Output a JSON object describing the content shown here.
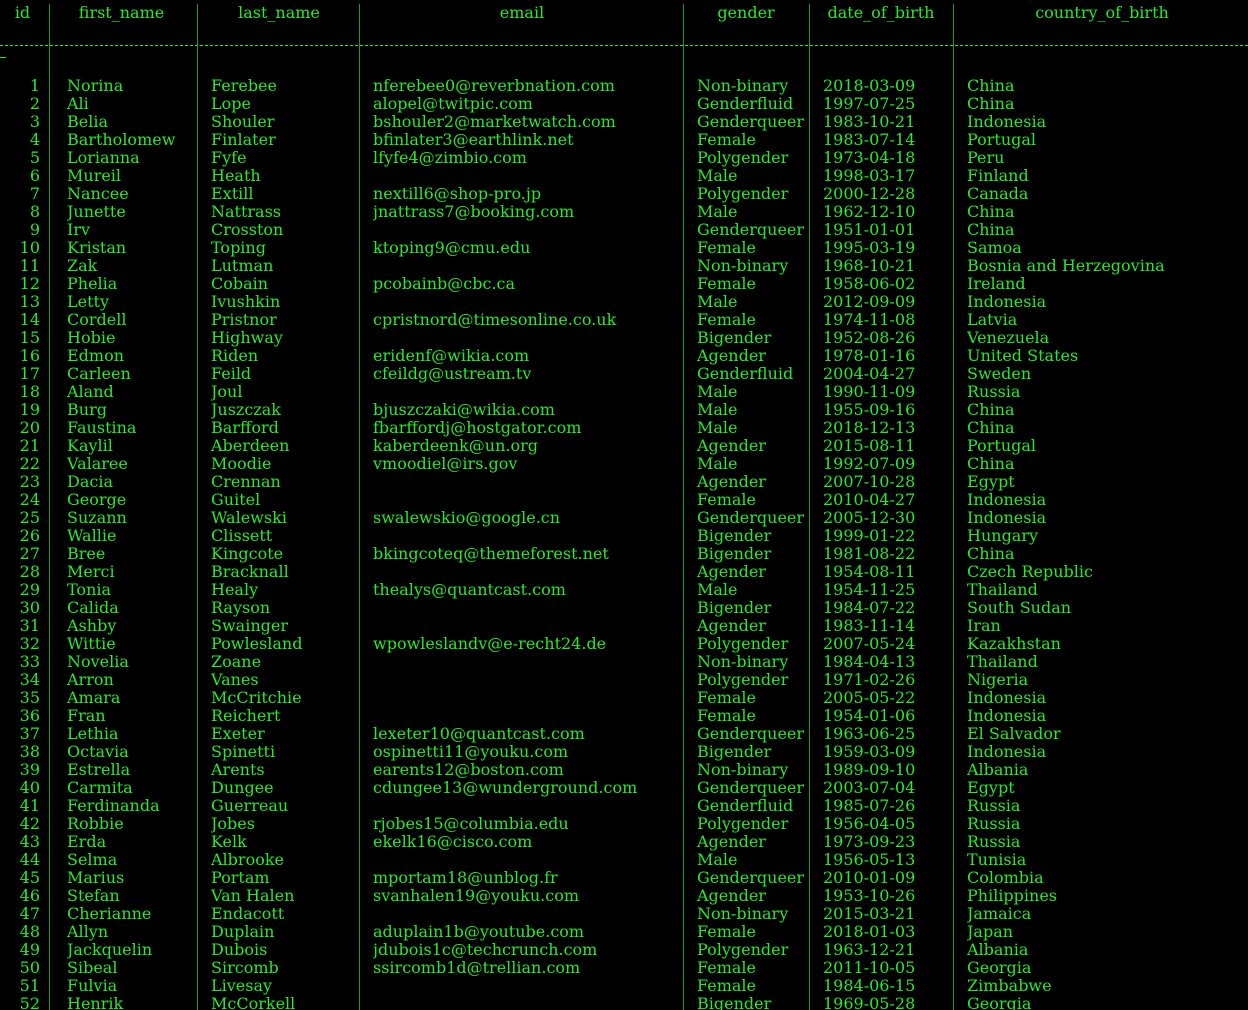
{
  "columns": [
    "id",
    "first_name",
    "last_name",
    "email",
    "gender",
    "date_of_birth",
    "country_of_birth"
  ],
  "rows": [
    [
      "1",
      "Norina",
      "Ferebee",
      "nferebee0@reverbnation.com",
      "Non-binary",
      "2018-03-09",
      "China"
    ],
    [
      "2",
      "Ali",
      "Lope",
      "alopel@twitpic.com",
      "Genderfluid",
      "1997-07-25",
      "China"
    ],
    [
      "3",
      "Belia",
      "Shouler",
      "bshouler2@marketwatch.com",
      "Genderqueer",
      "1983-10-21",
      "Indonesia"
    ],
    [
      "4",
      "Bartholomew",
      "Finlater",
      "bfinlater3@earthlink.net",
      "Female",
      "1983-07-14",
      "Portugal"
    ],
    [
      "5",
      "Lorianna",
      "Fyfe",
      "lfyfe4@zimbio.com",
      "Polygender",
      "1973-04-18",
      "Peru"
    ],
    [
      "6",
      "Mureil",
      "Heath",
      "",
      "Male",
      "1998-03-17",
      "Finland"
    ],
    [
      "7",
      "Nancee",
      "Extill",
      "nextill6@shop-pro.jp",
      "Polygender",
      "2000-12-28",
      "Canada"
    ],
    [
      "8",
      "Junette",
      "Nattrass",
      "jnattrass7@booking.com",
      "Male",
      "1962-12-10",
      "China"
    ],
    [
      "9",
      "Irv",
      "Crosston",
      "",
      "Genderqueer",
      "1951-01-01",
      "China"
    ],
    [
      "10",
      "Kristan",
      "Toping",
      "ktoping9@cmu.edu",
      "Female",
      "1995-03-19",
      "Samoa"
    ],
    [
      "11",
      "Zak",
      "Lutman",
      "",
      "Non-binary",
      "1968-10-21",
      "Bosnia and Herzegovina"
    ],
    [
      "12",
      "Phelia",
      "Cobain",
      "pcobainb@cbc.ca",
      "Female",
      "1958-06-02",
      "Ireland"
    ],
    [
      "13",
      "Letty",
      "Ivushkin",
      "",
      "Male",
      "2012-09-09",
      "Indonesia"
    ],
    [
      "14",
      "Cordell",
      "Pristnor",
      "cpristnord@timesonline.co.uk",
      "Female",
      "1974-11-08",
      "Latvia"
    ],
    [
      "15",
      "Hobie",
      "Highway",
      "",
      "Bigender",
      "1952-08-26",
      "Venezuela"
    ],
    [
      "16",
      "Edmon",
      "Riden",
      "eridenf@wikia.com",
      "Agender",
      "1978-01-16",
      "United States"
    ],
    [
      "17",
      "Carleen",
      "Feild",
      "cfeildg@ustream.tv",
      "Genderfluid",
      "2004-04-27",
      "Sweden"
    ],
    [
      "18",
      "Aland",
      "Joul",
      "",
      "Male",
      "1990-11-09",
      "Russia"
    ],
    [
      "19",
      "Burg",
      "Juszczak",
      "bjuszczaki@wikia.com",
      "Male",
      "1955-09-16",
      "China"
    ],
    [
      "20",
      "Faustina",
      "Barfford",
      "fbarffordj@hostgator.com",
      "Male",
      "2018-12-13",
      "China"
    ],
    [
      "21",
      "Kaylil",
      "Aberdeen",
      "kaberdeenk@un.org",
      "Agender",
      "2015-08-11",
      "Portugal"
    ],
    [
      "22",
      "Valaree",
      "Moodie",
      "vmoodiel@irs.gov",
      "Male",
      "1992-07-09",
      "China"
    ],
    [
      "23",
      "Dacia",
      "Crennan",
      "",
      "Agender",
      "2007-10-28",
      "Egypt"
    ],
    [
      "24",
      "George",
      "Guitel",
      "",
      "Female",
      "2010-04-27",
      "Indonesia"
    ],
    [
      "25",
      "Suzann",
      "Walewski",
      "swalewskio@google.cn",
      "Genderqueer",
      "2005-12-30",
      "Indonesia"
    ],
    [
      "26",
      "Wallie",
      "Clissett",
      "",
      "Bigender",
      "1999-01-22",
      "Hungary"
    ],
    [
      "27",
      "Bree",
      "Kingcote",
      "bkingcoteq@themeforest.net",
      "Bigender",
      "1981-08-22",
      "China"
    ],
    [
      "28",
      "Merci",
      "Bracknall",
      "",
      "Agender",
      "1954-08-11",
      "Czech Republic"
    ],
    [
      "29",
      "Tonia",
      "Healy",
      "thealys@quantcast.com",
      "Male",
      "1954-11-25",
      "Thailand"
    ],
    [
      "30",
      "Calida",
      "Rayson",
      "",
      "Bigender",
      "1984-07-22",
      "South Sudan"
    ],
    [
      "31",
      "Ashby",
      "Swainger",
      "",
      "Agender",
      "1983-11-14",
      "Iran"
    ],
    [
      "32",
      "Wittie",
      "Powlesland",
      "wpowleslandv@e-recht24.de",
      "Polygender",
      "2007-05-24",
      "Kazakhstan"
    ],
    [
      "33",
      "Novelia",
      "Zoane",
      "",
      "Non-binary",
      "1984-04-13",
      "Thailand"
    ],
    [
      "34",
      "Arron",
      "Vanes",
      "",
      "Polygender",
      "1971-02-26",
      "Nigeria"
    ],
    [
      "35",
      "Amara",
      "McCritchie",
      "",
      "Female",
      "2005-05-22",
      "Indonesia"
    ],
    [
      "36",
      "Fran",
      "Reichert",
      "",
      "Female",
      "1954-01-06",
      "Indonesia"
    ],
    [
      "37",
      "Lethia",
      "Exeter",
      "lexeter10@quantcast.com",
      "Genderqueer",
      "1963-06-25",
      "El Salvador"
    ],
    [
      "38",
      "Octavia",
      "Spinetti",
      "ospinetti11@youku.com",
      "Bigender",
      "1959-03-09",
      "Indonesia"
    ],
    [
      "39",
      "Estrella",
      "Arents",
      "earents12@boston.com",
      "Non-binary",
      "1989-09-10",
      "Albania"
    ],
    [
      "40",
      "Carmita",
      "Dungee",
      "cdungee13@wunderground.com",
      "Genderqueer",
      "2003-07-04",
      "Egypt"
    ],
    [
      "41",
      "Ferdinanda",
      "Guerreau",
      "",
      "Genderfluid",
      "1985-07-26",
      "Russia"
    ],
    [
      "42",
      "Robbie",
      "Jobes",
      "rjobes15@columbia.edu",
      "Polygender",
      "1956-04-05",
      "Russia"
    ],
    [
      "43",
      "Erda",
      "Kelk",
      "ekelk16@cisco.com",
      "Agender",
      "1973-09-23",
      "Russia"
    ],
    [
      "44",
      "Selma",
      "Albrooke",
      "",
      "Male",
      "1956-05-13",
      "Tunisia"
    ],
    [
      "45",
      "Marius",
      "Portam",
      "mportam18@unblog.fr",
      "Genderqueer",
      "2010-01-09",
      "Colombia"
    ],
    [
      "46",
      "Stefan",
      "Van Halen",
      "svanhalen19@youku.com",
      "Agender",
      "1953-10-26",
      "Philippines"
    ],
    [
      "47",
      "Cherianne",
      "Endacott",
      "",
      "Non-binary",
      "2015-03-21",
      "Jamaica"
    ],
    [
      "48",
      "Allyn",
      "Duplain",
      "aduplain1b@youtube.com",
      "Female",
      "2018-01-03",
      "Japan"
    ],
    [
      "49",
      "Jackquelin",
      "Dubois",
      "jdubois1c@techcrunch.com",
      "Polygender",
      "1963-12-21",
      "Albania"
    ],
    [
      "50",
      "Sibeal",
      "Sircomb",
      "ssircomb1d@trellian.com",
      "Female",
      "2011-10-05",
      "Georgia"
    ],
    [
      "51",
      "Fulvia",
      "Livesay",
      "",
      "Female",
      "1984-06-15",
      "Zimbabwe"
    ],
    [
      "52",
      "Henrik",
      "McCorkell",
      "",
      "Bigender",
      "1969-05-28",
      "Georgia"
    ]
  ],
  "colors": {
    "text": "#2be82b",
    "background": "#000000"
  }
}
